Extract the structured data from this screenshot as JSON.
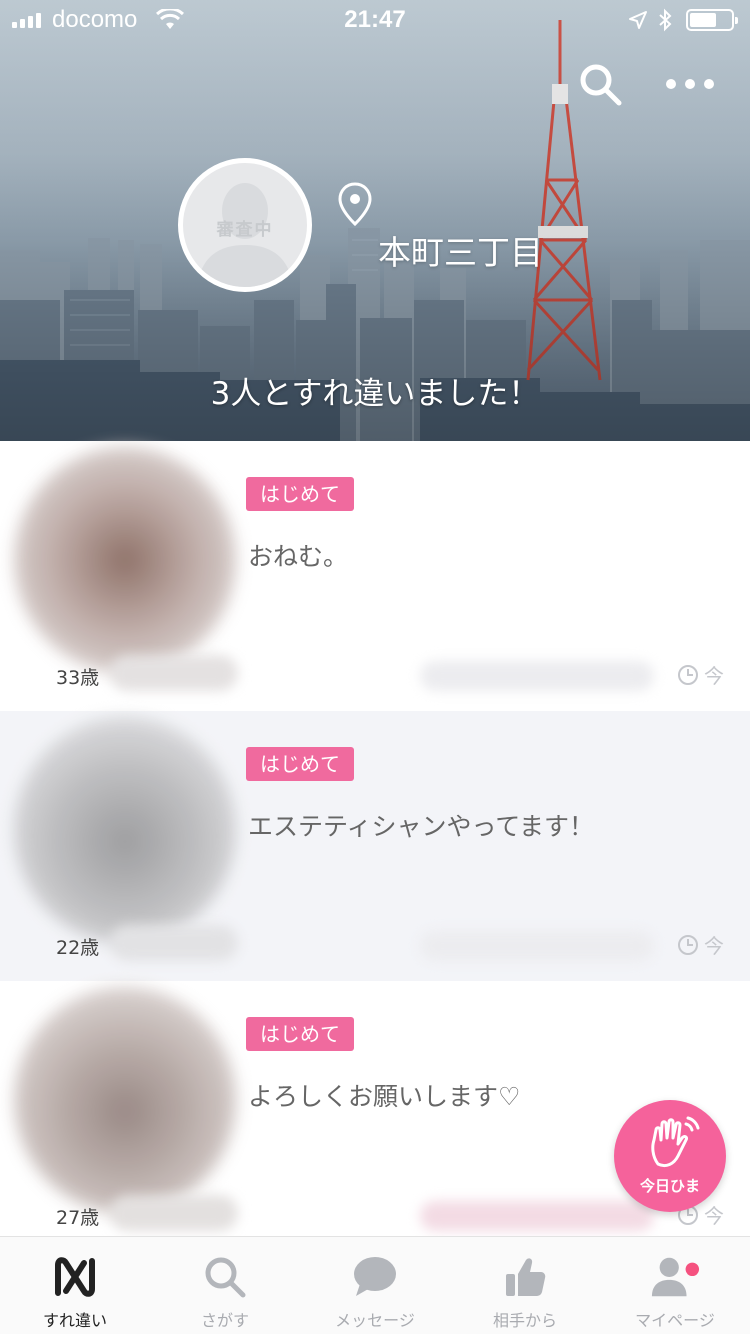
{
  "status_bar": {
    "carrier": "docomo",
    "time": "21:47"
  },
  "header": {
    "avatar_status": "審査中",
    "location": "本町三丁目",
    "passed_message": "3人とすれ違いました！",
    "icons": [
      "search-icon",
      "more-icon",
      "location-pin-icon"
    ]
  },
  "users": [
    {
      "badge": "はじめて",
      "message": "おねむ。",
      "age": "33歳",
      "time_ago": "今",
      "photo_color": "#a8908a"
    },
    {
      "badge": "はじめて",
      "message": "エステティシャンやってます！",
      "age": "22歳",
      "time_ago": "今",
      "photo_color": "#a6a6a9"
    },
    {
      "badge": "はじめて",
      "message": "よろしくお願いします♡",
      "age": "27歳",
      "time_ago": "今",
      "photo_color": "#a59893"
    }
  ],
  "fab": {
    "label": "今日ひま",
    "icon": "waving-hand-icon"
  },
  "tab_bar": {
    "items": [
      {
        "label": "すれ違い",
        "icon": "surechigai-icon",
        "active": true
      },
      {
        "label": "さがす",
        "icon": "search-icon",
        "active": false
      },
      {
        "label": "メッセージ",
        "icon": "chat-bubble-icon",
        "active": false
      },
      {
        "label": "相手から",
        "icon": "thumbs-up-icon",
        "active": false
      },
      {
        "label": "マイページ",
        "icon": "profile-icon",
        "active": false
      }
    ]
  },
  "colors": {
    "accent_pink": "#f06a9e",
    "fab_pink": "#f5629b",
    "alt_row": "#f3f4f8"
  }
}
